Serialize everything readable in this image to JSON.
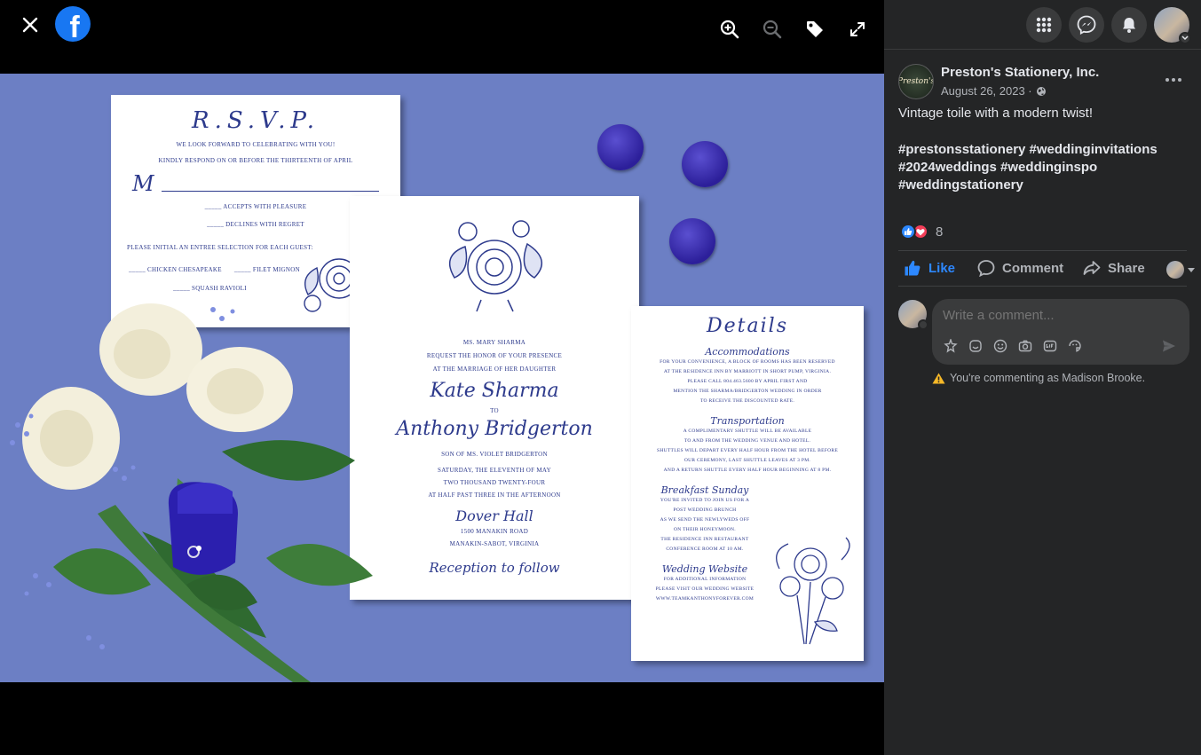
{
  "viewer": {
    "close_label": "✕",
    "logo_letter": "f"
  },
  "photo": {
    "rsvp": {
      "title": "R.S.V.P.",
      "line1": "We look forward to celebrating with you!",
      "line2": "Kindly respond on or before the thirteenth of April",
      "m_label": "M",
      "accepts": "_____ Accepts with pleasure",
      "declines": "_____ Declines with regret",
      "entree_prompt": "Please initial an entree selection for each guest:",
      "option1": "_____ Chicken Chesapeake",
      "option2": "_____ Filet Mignon",
      "option3": "_____ Squash Ravioli"
    },
    "invite": {
      "host": "Ms. Mary Sharma",
      "request1": "request the honor of your presence",
      "request2": "at the marriage of her daughter",
      "bride": "Kate Sharma",
      "to": "to",
      "groom": "Anthony Bridgerton",
      "son_of": "son of Ms. Violet Bridgerton",
      "date1": "Saturday, the eleventh of May",
      "date2": "two thousand twenty-four",
      "time": "at half past three in the afternoon",
      "venue": "Dover Hall",
      "address1": "1500 Manakin Road",
      "address2": "Manakin-Sabot, Virginia",
      "reception": "Reception to follow"
    },
    "details": {
      "title": "Details",
      "acc_heading": "Accommodations",
      "acc1": "For your convenience, a block of rooms has been reserved",
      "acc2": "at the Residence Inn by Marriott in Short Pump, Virginia.",
      "acc3": "Please call 804.463.5600 by April first and",
      "acc4": "mention the Sharma/Bridgerton wedding in order",
      "acc5": "to receive the discounted rate.",
      "trans_heading": "Transportation",
      "trans1": "A complimentary shuttle will be available",
      "trans2": "to and from the wedding venue and hotel.",
      "trans3": "Shuttles will depart every half hour from the hotel before",
      "trans4": "our ceremony, last shuttle leaves at 3 pm.",
      "trans5": "and a return shuttle every half hour beginning at 8 pm.",
      "brunch_heading": "Breakfast Sunday",
      "brunch1": "You're invited to join us for a",
      "brunch2": "post wedding brunch",
      "brunch3": "as we send the newlyweds off",
      "brunch4": "on their honeymoon.",
      "brunch5": "The Residence Inn Restaurant",
      "brunch6": "Conference room at 10 am.",
      "web_heading": "Wedding Website",
      "web1": "For additional information",
      "web2": "please visit our wedding website",
      "web3": "www.teamkanthonyforever.com"
    }
  },
  "post": {
    "page_name": "Preston's Stationery, Inc.",
    "avatar_text": "Preston's",
    "date": "August 26, 2023 ·",
    "caption": "Vintage toile with a modern twist!",
    "hashtags_line1": "#prestonsstationery #weddinginvitations",
    "hashtags_line2": "#2024weddings #weddinginspo",
    "hashtags_line3": "#weddingstationery",
    "reaction_count": "8",
    "like_label": "Like",
    "comment_label": "Comment",
    "share_label": "Share",
    "comment_placeholder": "Write a comment...",
    "commenting_as": "You're commenting as Madison Brooke."
  },
  "colors": {
    "fb_blue": "#1877f2",
    "like_blue": "#2d88ff",
    "photo_bg": "#6c7fc4",
    "ink": "#2d3a8c",
    "sidebar_bg": "#242526"
  }
}
